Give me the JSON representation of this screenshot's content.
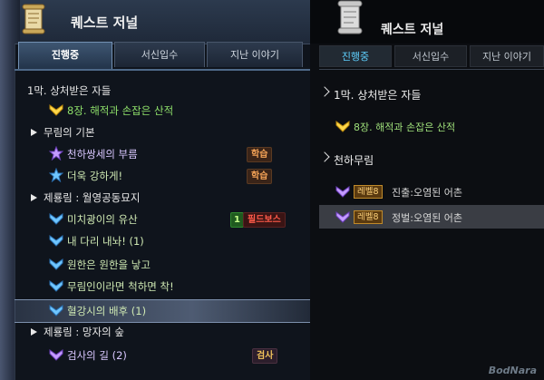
{
  "left": {
    "title": "퀘스트 저널",
    "tabs": [
      {
        "label": "진행중",
        "active": true
      },
      {
        "label": "서신입수",
        "active": false
      },
      {
        "label": "지난 이야기",
        "active": false
      }
    ],
    "rows": [
      {
        "type": "cat",
        "label": "1막. 상처받은 자들"
      },
      {
        "type": "quest",
        "label": "8장. 해적과 손잡은 산적",
        "icon": "yellow-chevron-icon"
      },
      {
        "type": "cat",
        "label": "무림의 기본"
      },
      {
        "type": "quest",
        "label": "천하쌍세의 부름",
        "icon": "purple-star-icon",
        "badge": "학습"
      },
      {
        "type": "quest",
        "label": "더욱 강하게!",
        "icon": "blue-star-icon",
        "badge": "학습"
      },
      {
        "type": "cat",
        "label": "제룡림 : 월영공동묘지"
      },
      {
        "type": "quest",
        "label": "미치광이의 유산",
        "icon": "blue-chevron-icon",
        "badge_num": "1",
        "badge": "필드보스"
      },
      {
        "type": "quest",
        "label": "내 다리 내놔! (1)",
        "icon": "blue-chevron-icon"
      },
      {
        "type": "quest",
        "label": "원한은 원한을 낳고",
        "icon": "blue-chevron-icon"
      },
      {
        "type": "quest",
        "label": "무림인이라면 척하면 착!",
        "icon": "blue-chevron-icon"
      },
      {
        "type": "quest",
        "label": "혈강시의 배후 (1)",
        "icon": "blue-chevron-icon",
        "selected": true
      },
      {
        "type": "cat",
        "label": "제룡림 : 망자의 숲"
      },
      {
        "type": "quest",
        "label": "검사의 길 (2)",
        "icon": "purple-chevron-icon",
        "badge": "검사"
      }
    ]
  },
  "right": {
    "title": "퀘스트 저널",
    "tabs": [
      {
        "label": "진행중",
        "active": true
      },
      {
        "label": "서신입수",
        "active": false
      },
      {
        "label": "지난 이야기",
        "active": false
      }
    ],
    "rows": [
      {
        "type": "cat",
        "label": "1막. 상처받은 자들"
      },
      {
        "type": "quest",
        "label": "8장. 해적과 손잡은 산적",
        "icon": "yellow-chevron-icon"
      },
      {
        "type": "cat",
        "label": "천하무림"
      },
      {
        "type": "quest",
        "level": "레벨8",
        "label": "진출:오염된 어촌",
        "icon": "purple-chevron-icon"
      },
      {
        "type": "quest",
        "level": "레벨8",
        "label": "정벌:오염된 어촌",
        "icon": "purple-chevron-icon",
        "selected": true
      }
    ],
    "watermark": "BodNara"
  },
  "colors": {
    "accent_blue": "#5fd0ff",
    "quest_green": "#9fe07a",
    "learn_orange": "#f3a256",
    "fieldboss_red": "#ff5a4a"
  }
}
